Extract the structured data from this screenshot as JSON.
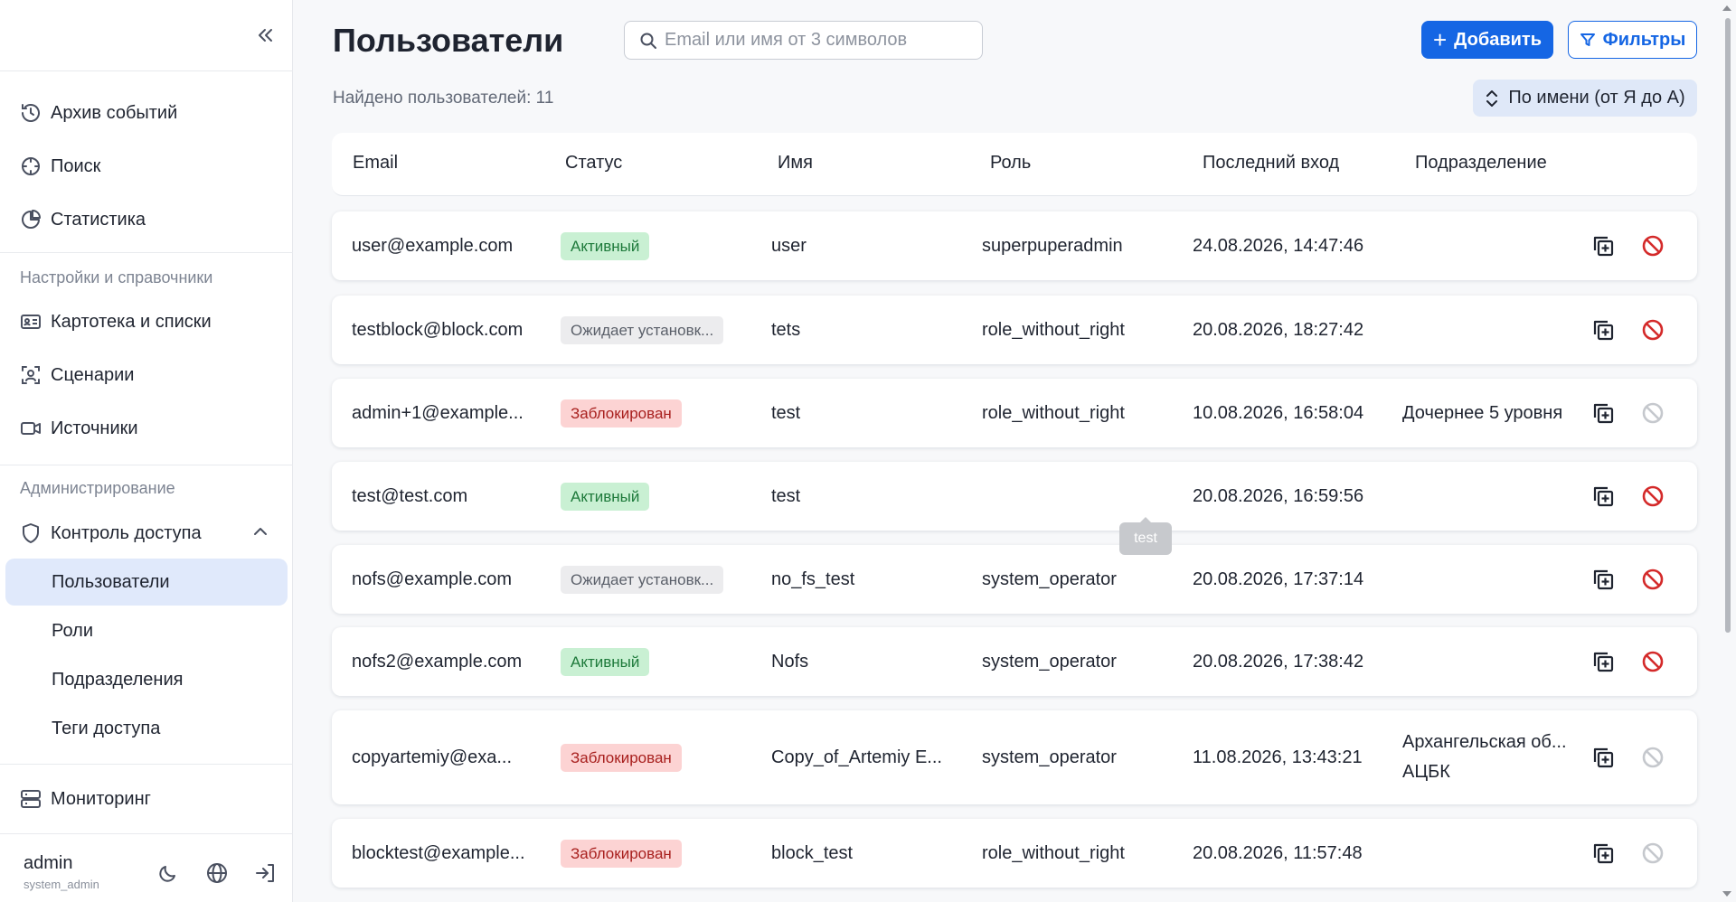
{
  "sidebar": {
    "items_top": [
      {
        "label": "Архив событий",
        "icon": "history-icon"
      },
      {
        "label": "Поиск",
        "icon": "crosshair-icon"
      },
      {
        "label": "Статистика",
        "icon": "pie-chart-icon"
      }
    ],
    "section_settings": "Настройки и справочники",
    "items_settings": [
      {
        "label": "Картотека и списки",
        "icon": "id-card-icon"
      },
      {
        "label": "Сценарии",
        "icon": "face-scan-icon"
      },
      {
        "label": "Источники",
        "icon": "video-camera-icon"
      }
    ],
    "section_admin": "Администрирование",
    "access_control": {
      "label": "Контроль доступа",
      "icon": "shield-icon"
    },
    "access_sub": [
      "Пользователи",
      "Роли",
      "Подразделения",
      "Теги доступа"
    ],
    "monitoring": {
      "label": "Мониторинг",
      "icon": "server-icon"
    },
    "user": {
      "name": "admin",
      "role": "system_admin"
    }
  },
  "header": {
    "title": "Пользователи",
    "search_placeholder": "Email или имя от 3 символов",
    "add_label": "Добавить",
    "filter_label": "Фильтры"
  },
  "found_count": "Найдено пользователей: 11",
  "sort_label": "По имени (от Я до А)",
  "columns": [
    "Email",
    "Статус",
    "Имя",
    "Роль",
    "Последний вход",
    "Подразделение"
  ],
  "rows": [
    {
      "email": "user@example.com",
      "status": "Активный",
      "status_type": "active",
      "name": "user",
      "role": "superpuperadmin",
      "last_login": "24.08.2026, 14:47:46",
      "division": "",
      "block_enabled": true
    },
    {
      "email": "testblock@block.com",
      "status": "Ожидает установк...",
      "status_type": "pending",
      "name": "tets",
      "role": "role_without_right",
      "last_login": "20.08.2026, 18:27:42",
      "division": "",
      "block_enabled": true
    },
    {
      "email": "admin+1@example...",
      "status": "Заблокирован",
      "status_type": "blocked",
      "name": "test",
      "role": "role_without_right",
      "last_login": "10.08.2026, 16:58:04",
      "division": "Дочернее 5 уровня",
      "block_enabled": false
    },
    {
      "email": "test@test.com",
      "status": "Активный",
      "status_type": "active",
      "name": "test",
      "role": "",
      "last_login": "20.08.2026, 16:59:56",
      "division": "",
      "block_enabled": true
    },
    {
      "email": "nofs@example.com",
      "status": "Ожидает установк...",
      "status_type": "pending",
      "name": "no_fs_test",
      "role": "system_operator",
      "last_login": "20.08.2026, 17:37:14",
      "division": "",
      "block_enabled": true
    },
    {
      "email": "nofs2@example.com",
      "status": "Активный",
      "status_type": "active",
      "name": "Nofs",
      "role": "system_operator",
      "last_login": "20.08.2026, 17:38:42",
      "division": "",
      "block_enabled": true
    },
    {
      "email": "copyartemiy@exa...",
      "status": "Заблокирован",
      "status_type": "blocked",
      "name": "Copy_of_Artemiy E...",
      "role": "system_operator",
      "last_login": "11.08.2026, 13:43:21",
      "division": "Архангельская об...",
      "division_line2": "АЦБК",
      "block_enabled": false
    },
    {
      "email": "blocktest@example...",
      "status": "Заблокирован",
      "status_type": "blocked",
      "name": "block_test",
      "role": "role_without_right",
      "last_login": "20.08.2026, 11:57:48",
      "division": "",
      "block_enabled": false
    }
  ],
  "tooltip": "test",
  "colors": {
    "primary": "#1566e4",
    "active_bg": "#c9f0d3",
    "pending_bg": "#ececee",
    "blocked_bg": "#fcd3d3",
    "block_icon_red": "#d42a2a"
  }
}
